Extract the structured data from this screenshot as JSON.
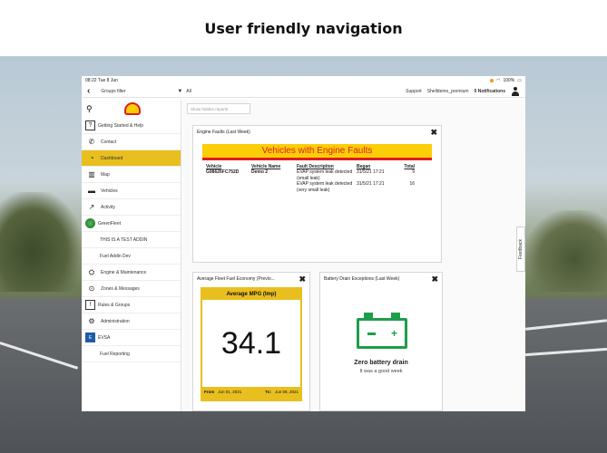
{
  "headline": "User friendly navigation",
  "status_bar": {
    "time": "08:22",
    "date": "Tue 8 Jun",
    "battery": "100%"
  },
  "top_bar": {
    "groups_filter": "Groups filter",
    "all": "All",
    "support": "Support",
    "user": "Shelldemo_premium",
    "notifications": "0 Notifications"
  },
  "sidebar": {
    "items": [
      {
        "label": "Getting Started & Help",
        "icon": "help-icon"
      },
      {
        "label": "Contact",
        "icon": "phone-icon"
      },
      {
        "label": "Dashboard",
        "icon": "dashboard-icon",
        "active": true
      },
      {
        "label": "Map",
        "icon": "map-icon"
      },
      {
        "label": "Vehicles",
        "icon": "truck-icon"
      },
      {
        "label": "Activity",
        "icon": "activity-icon"
      },
      {
        "label": "GreenFleet",
        "icon": "globe-icon"
      },
      {
        "label": "THIS IS A TEST ADDIN"
      },
      {
        "label": "Fuel Addin Dev"
      },
      {
        "label": "Engine & Maintenance",
        "icon": "engine-icon"
      },
      {
        "label": "Zones & Messages",
        "icon": "pin-icon"
      },
      {
        "label": "Rules & Groups",
        "icon": "exclamation-icon"
      },
      {
        "label": "Administration",
        "icon": "gear-icon"
      },
      {
        "label": "EVSA",
        "icon": "evsa-icon"
      },
      {
        "label": "Fuel Reporting"
      }
    ]
  },
  "main": {
    "show_hidden_reports": "Show hidden reports",
    "engine_faults": {
      "title": "Engine Faults (Last Week)",
      "banner": "Vehicles with Engine Faults",
      "headers": {
        "vehicle": "Vehicle",
        "vehicle_name": "Vehicle Name",
        "fault": "Fault Description",
        "began": "Began",
        "total": "Total"
      },
      "rows": [
        {
          "vehicle": "G98626FC752D",
          "vehicle_name": "Demo 2",
          "fault": "EVAP system leak detected (small leak)",
          "began": "31/5/21 17:21",
          "total": "9"
        },
        {
          "vehicle": "",
          "vehicle_name": "",
          "fault": "EVAP system leak detected (very small leak)",
          "began": "31/5/21 17:21",
          "total": "16"
        }
      ]
    },
    "fuel_economy": {
      "title": "Average Fleet Fuel Economy (Previo...",
      "box_title": "Average MPG (Imp)",
      "value": "34.1",
      "from_label": "From",
      "from_date": "Jun 01, 2021",
      "to_label": "To:",
      "to_date": "Jun 08, 2021"
    },
    "battery_drain": {
      "title": "Battery Drain Exceptions (Last Week)",
      "message": "Zero battery drain",
      "sub": "It was a good week"
    },
    "feedback": "Feedback"
  }
}
